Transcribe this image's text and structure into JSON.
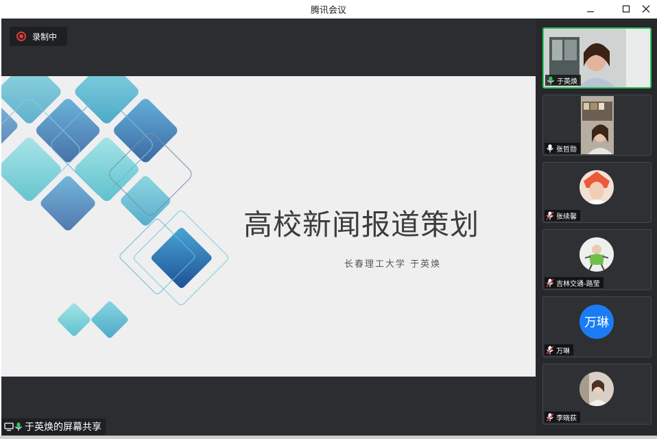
{
  "window": {
    "title": "腾讯会议"
  },
  "recording": {
    "label": "录制中"
  },
  "slide": {
    "title": "高校新闻报道策划",
    "subtitle": "长春理工大学    于英焕"
  },
  "screen_share": {
    "label": "于英焕的屏幕共享"
  },
  "participants": [
    {
      "name": "于英焕",
      "mic": "on",
      "video": "camera",
      "active": true
    },
    {
      "name": "张哲勋",
      "mic": "on",
      "video": "camera"
    },
    {
      "name": "张续馨",
      "mic": "muted",
      "video": "avatar-photo"
    },
    {
      "name": "吉林交通-路莹",
      "mic": "muted",
      "video": "avatar-photo"
    },
    {
      "name": "万琳",
      "mic": "muted",
      "video": "avatar-text",
      "avatar_text": "万琳",
      "avatar_color": "#1a7cf5"
    },
    {
      "name": "李晓荻",
      "mic": "muted",
      "video": "avatar-photo"
    }
  ],
  "colors": {
    "active_border": "#2fc25b",
    "recording_red": "#e03b3b",
    "mic_on": "#2fc25b",
    "mic_muted": "#e03b3b"
  }
}
